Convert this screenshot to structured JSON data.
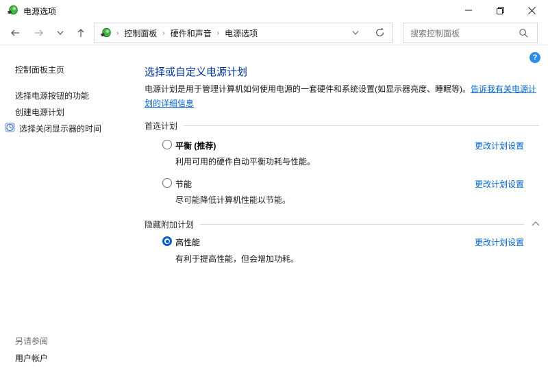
{
  "titlebar": {
    "title": "电源选项"
  },
  "navbar": {
    "breadcrumb": {
      "items": [
        "控制面板",
        "硬件和声音",
        "电源选项"
      ]
    },
    "search_placeholder": "搜索控制面板"
  },
  "sidebar": {
    "home": "控制面板主页",
    "tasks": [
      "选择电源按钮的功能",
      "创建电源计划",
      "选择关闭显示器的时间"
    ],
    "see_also": "另请参阅",
    "see_also_links": [
      "用户帐户"
    ]
  },
  "main": {
    "heading": "选择或自定义电源计划",
    "intro": "电源计划是用于管理计算机如何使用电源的一套硬件和系统设置(如显示器亮度、睡眠等)。",
    "intro_link": "告诉我有关电源计划的详细信息",
    "help_label": "?",
    "groups": [
      {
        "label": "首选计划",
        "plans": [
          {
            "name": "平衡 (推荐)",
            "desc": "利用可用的硬件自动平衡功耗与性能。",
            "link": "更改计划设置",
            "checked": false
          },
          {
            "name": "节能",
            "desc": "尽可能降低计算机性能以节能。",
            "link": "更改计划设置",
            "checked": false
          }
        ]
      },
      {
        "label": "隐藏附加计划",
        "plans": [
          {
            "name": "高性能",
            "desc": "有利于提高性能，但会增加功耗。",
            "link": "更改计划设置",
            "checked": true
          }
        ]
      }
    ]
  },
  "colors": {
    "heading": "#003399",
    "link": "#0066cc",
    "radio_selected": "#0a5dc2",
    "help_icon": "#2e8be6"
  }
}
